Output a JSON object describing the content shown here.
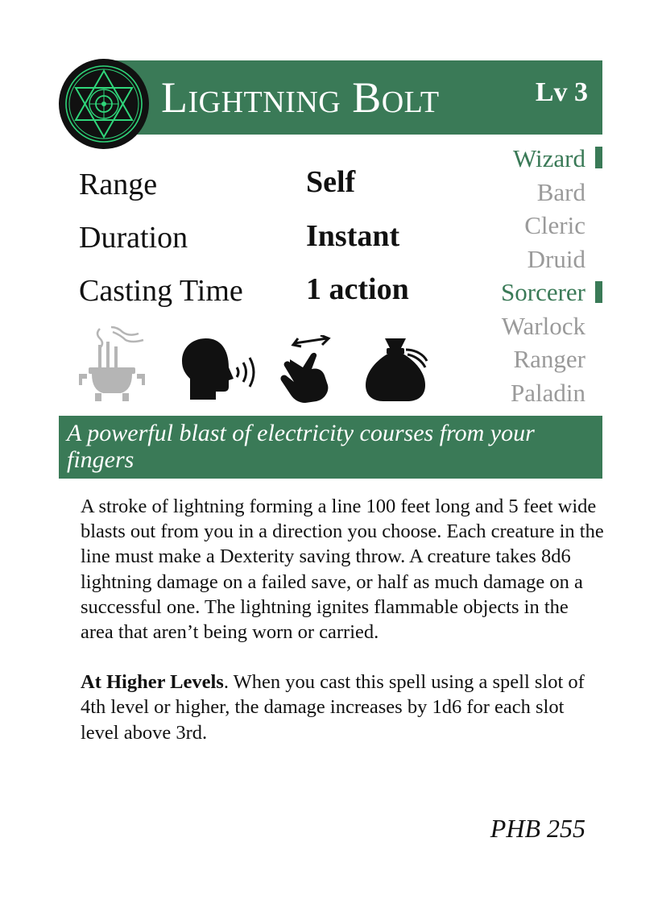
{
  "spell": {
    "name": "Lightning Bolt",
    "level": "Lv 3",
    "stats": [
      {
        "label": "Range",
        "value": "Self"
      },
      {
        "label": "Duration",
        "value": "Instant"
      },
      {
        "label": "Casting Time",
        "value": "1 action"
      }
    ],
    "classes": [
      {
        "name": "Wizard",
        "active": true
      },
      {
        "name": "Bard",
        "active": false
      },
      {
        "name": "Cleric",
        "active": false
      },
      {
        "name": "Druid",
        "active": false
      },
      {
        "name": "Sorcerer",
        "active": true
      },
      {
        "name": "Warlock",
        "active": false
      },
      {
        "name": "Ranger",
        "active": false
      },
      {
        "name": "Paladin",
        "active": false
      }
    ],
    "components": [
      {
        "icon": "ritual-censer-icon",
        "active": false
      },
      {
        "icon": "verbal-speaking-head-icon",
        "active": true
      },
      {
        "icon": "somatic-hand-icon",
        "active": true
      },
      {
        "icon": "material-pouch-icon",
        "active": true
      }
    ],
    "tagline": "A powerful blast of electricity courses from your fingers",
    "description": "A stroke of lightning forming a line 100 feet long and 5 feet wide blasts out from you in a direction you choose. Each creature in the line must make a Dexterity saving throw. A creature takes 8d6 lightning damage on a failed save, or half as much damage on a successful one. The lightning ignites flammable objects in the area that aren’t being worn or carried.",
    "higher_levels_label": "At Higher Levels",
    "higher_levels_text": ". When you cast this spell using a spell slot of 4th level or higher, the damage increases by 1d6 for each slot level above 3rd.",
    "source": "PHB 255"
  },
  "colors": {
    "accent": "#3a7a57",
    "inactive": "#9a9a9a",
    "emblem_glow": "#2fd67a"
  }
}
